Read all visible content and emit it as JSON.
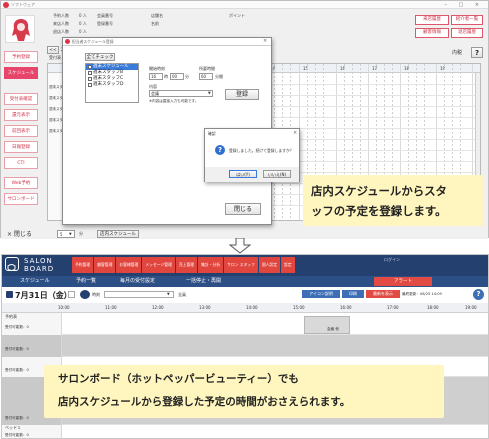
{
  "top_window": {
    "title": "ソフトウェア",
    "window_controls": "– □ ×",
    "info": {
      "rows": [
        {
          "label": "予約人数",
          "value": "0 人",
          "label2": "会員番号"
        },
        {
          "label": "来店人数",
          "value": "0 人",
          "label2": "登録番号"
        },
        {
          "label": "退店人数",
          "value": "0 人",
          "label2": ""
        }
      ],
      "field_a": "店舗名",
      "field_b": "名前",
      "field_c": "ポイント"
    },
    "right_buttons": [
      "来店履歴",
      "紹介者一覧",
      "顧客情報",
      "退店履歴"
    ],
    "right_label": "内税",
    "help_icon_text": "?",
    "date_nav": {
      "prev": "<<",
      "date": "202"
    },
    "toolbar_label": "受付表",
    "sidebar": [
      {
        "label": "予約登録",
        "active": false
      },
      {
        "label": "スケジュール",
        "active": true
      },
      {
        "label": "受付表確認",
        "active": false
      },
      {
        "label": "還元表示",
        "active": false
      },
      {
        "label": "前回表示",
        "active": false
      },
      {
        "label": "日報登録",
        "active": false
      },
      {
        "label": "CTI",
        "active": false
      },
      {
        "label": "Web予約",
        "active": false
      },
      {
        "label": "サロンボード",
        "active": false
      }
    ],
    "close_label": "× 閉じる",
    "interval_value": "5",
    "interval_unit": "分",
    "schedule_button": "店内スケジュール",
    "grid_hours": [
      "14",
      "15",
      "16",
      "17",
      "18",
      "19"
    ],
    "left_rows": [
      "週末スタッフ",
      "週末スタッフ",
      "週末スタッフ",
      "週末スタッフ",
      "週末スタッフ"
    ]
  },
  "dialog1": {
    "title": "担当者スケジュール登録",
    "check_all": "全てチェック",
    "list": [
      {
        "label": "週末スケジュール",
        "selected": true
      },
      {
        "label": "週末スタッフB",
        "selected": false
      },
      {
        "label": "週末スタッフC",
        "selected": false
      },
      {
        "label": "週末スタッフD",
        "selected": false
      }
    ],
    "start_label": "開始時刻",
    "duration_label": "所要時間",
    "start_hour": "16",
    "start_min": "00",
    "hour_unit": "時",
    "min_unit": "分",
    "duration_val": "60",
    "duration_unit": "分間",
    "content_label": "内容",
    "content_value": "会議",
    "note": "※内容は直接入力も可能です。",
    "register_button": "登録",
    "close_button": "閉じる"
  },
  "dialog2": {
    "title": "確認",
    "message": "登録しました。続けて登録しますか？",
    "yes": "はい(Y)",
    "no": "いいえ(N)"
  },
  "callout1": {
    "line1": "店内スケジュールからスタ",
    "line2": "ッフの予定を登録します。"
  },
  "salon_board": {
    "logo_top": "SALON",
    "logo_bottom": "BOARD",
    "user": "ログイン",
    "nav": [
      "予約管理",
      "顧客管理",
      "お客様管理",
      "メッセージ管理",
      "売上管理",
      "集計・分析",
      "サロン スタッフ",
      "個人設定",
      "設定"
    ],
    "sub": [
      "スケジュール",
      "予約一覧",
      "毎月の受付設定",
      "一括停止・再開"
    ],
    "alert_button": "アラート",
    "date": "7月31日（金）",
    "today_label": "今日",
    "select_label": "時刻",
    "display_label": "全員",
    "btn_icon": "アイコン説明",
    "btn_print": "印刷",
    "btn_latest": "最新を表示",
    "updated": "最終更新：06/25 14:09",
    "help": "?",
    "time_labels": [
      "10:00",
      "11:00",
      "12:00",
      "13:00",
      "14:00",
      "15:00",
      "16:00",
      "17:00",
      "18:00",
      "19:00"
    ],
    "rows": [
      {
        "label": "予約表",
        "sub": "受付可能数：0"
      },
      {
        "label": "",
        "sub": "受付可能数：0"
      },
      {
        "label": "",
        "sub": "受付可能数：0"
      },
      {
        "label": "",
        "sub": "受付可能数：0"
      },
      {
        "label": "ベッド１",
        "sub": "受付可能数：0"
      }
    ],
    "event_label": "会議 他"
  },
  "callout2": {
    "line1": "サロンボード（ホットペッパービューティー）でも",
    "line2": "店内スケジュールから登録した予定の時間がおさえられます。"
  }
}
